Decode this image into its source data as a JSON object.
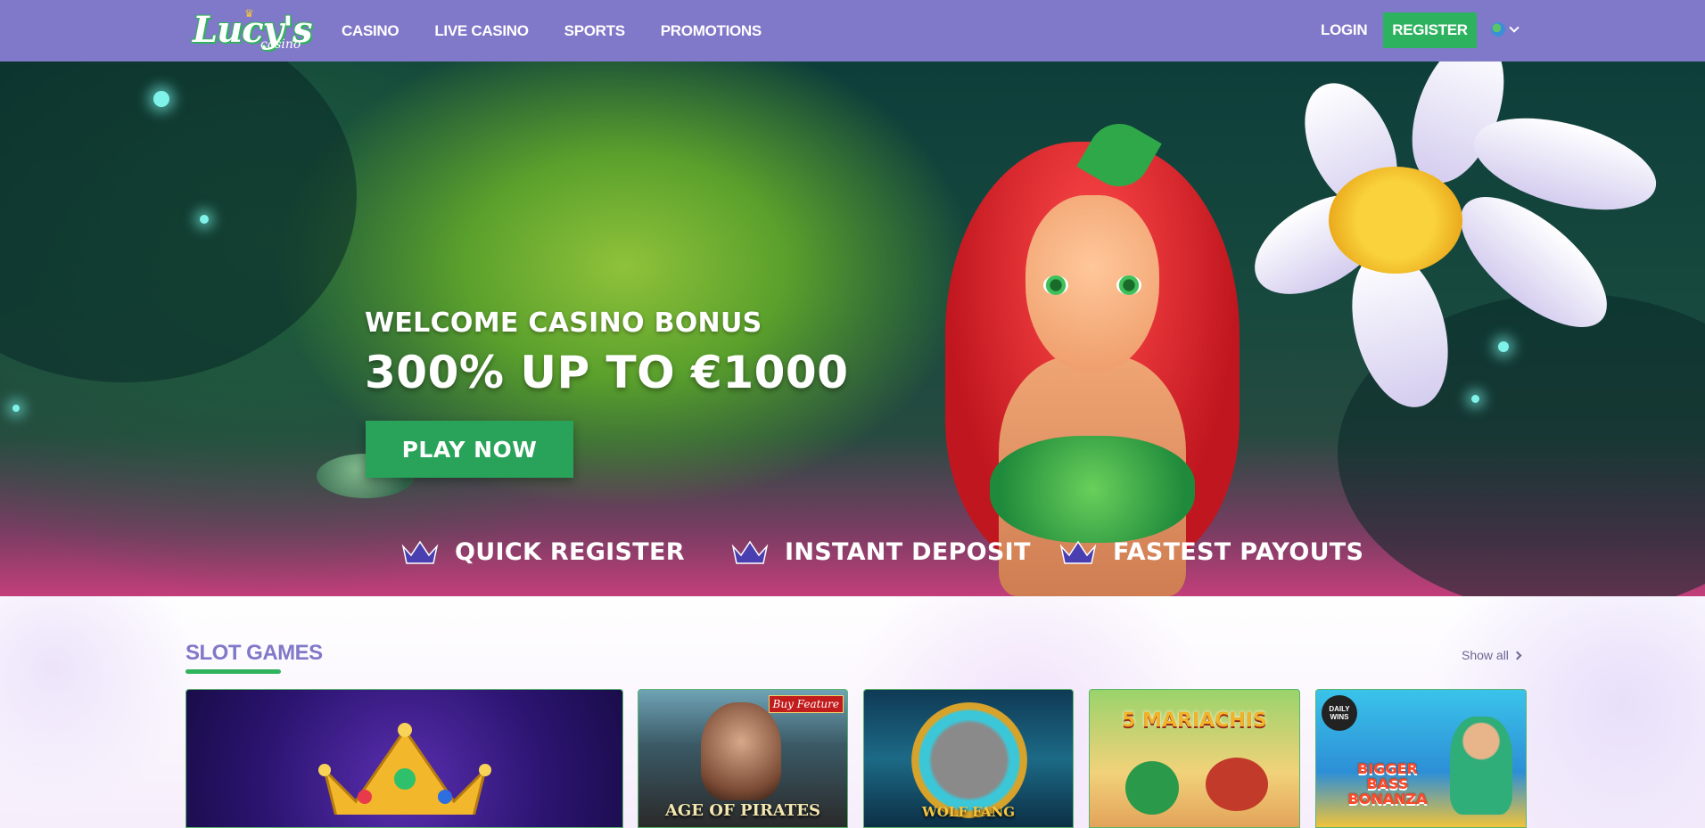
{
  "header": {
    "logo_text": "Lucy's",
    "logo_sub": "casino",
    "nav": [
      "CASINO",
      "LIVE CASINO",
      "SPORTS",
      "PROMOTIONS"
    ],
    "login_label": "LOGIN",
    "register_label": "REGISTER",
    "language_icon": "globe-icon"
  },
  "hero": {
    "subtitle": "WELCOME CASINO BONUS",
    "title": "300% UP TO €1000",
    "cta_label": "PLAY NOW",
    "features": [
      "QUICK REGISTER",
      "INSTANT DEPOSIT",
      "FASTEST PAYOUTS"
    ]
  },
  "slots": {
    "title": "SLOT GAMES",
    "show_all_label": "Show all",
    "games": [
      {
        "name": "",
        "badge": ""
      },
      {
        "name": "AGE OF PIRATES",
        "badge": "Buy Feature"
      },
      {
        "name": "WOLF FANG",
        "badge": ""
      },
      {
        "name": "5 MARIACHIS",
        "badge": ""
      },
      {
        "name": "BIGGER BASS BONANZA",
        "badge": "DAILY WINS"
      }
    ]
  },
  "colors": {
    "header_bg": "#8078c8",
    "accent_green": "#2db25f",
    "section_title": "#8078c8"
  }
}
